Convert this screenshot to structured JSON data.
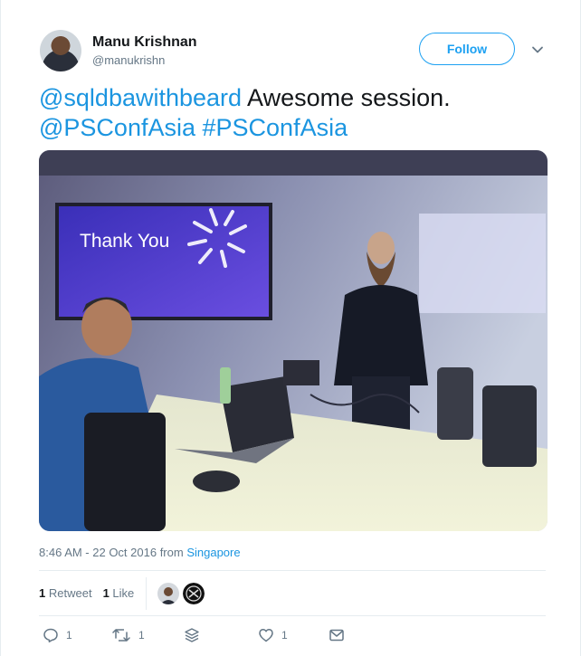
{
  "author": {
    "display_name": "Manu Krishnan",
    "handle": "@manukrishn"
  },
  "follow_label": "Follow",
  "tweet": {
    "mention": "@sqldbawithbeard",
    "text_plain": " Awesome session.",
    "mention2": "@PSConfAsia",
    "hashtag": "#PSConfAsia"
  },
  "photo": {
    "screen_text": "Thank You"
  },
  "meta": {
    "timestamp": "8:46 AM - 22 Oct 2016 from",
    "place": "Singapore"
  },
  "stats": {
    "retweet_count": "1",
    "retweet_label": "Retweet",
    "like_count": "1",
    "like_label": "Like"
  },
  "actions": {
    "reply_count": "1",
    "retweet_count": "1",
    "like_count": "1"
  },
  "colors": {
    "accent": "#1da1f2",
    "link": "#1b95e0",
    "muted": "#657786"
  },
  "icons": [
    "chevron-down-icon",
    "reply-icon",
    "retweet-icon",
    "stack-icon",
    "heart-icon",
    "message-icon"
  ]
}
